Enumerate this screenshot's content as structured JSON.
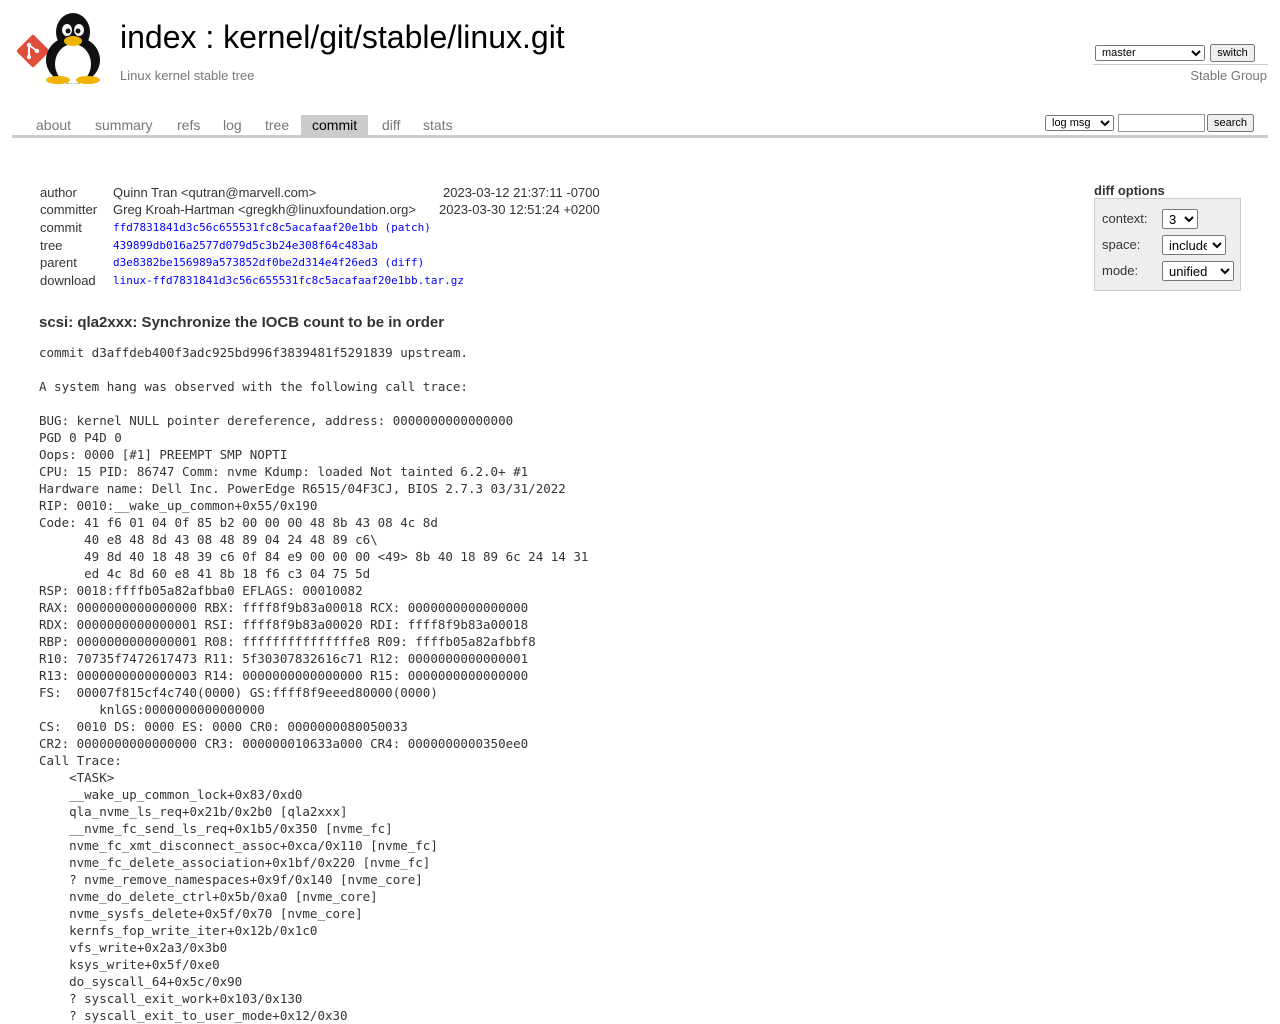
{
  "header": {
    "title_index": "index",
    "title_sep": " : ",
    "title_repo": "kernel/git/stable/linux.git",
    "description": "Linux kernel stable tree",
    "owner": "Stable Group",
    "branch_selected": "master",
    "switch_label": "switch"
  },
  "tabs": [
    {
      "label": "about"
    },
    {
      "label": "summary"
    },
    {
      "label": "refs"
    },
    {
      "label": "log"
    },
    {
      "label": "tree"
    },
    {
      "label": "commit"
    },
    {
      "label": "diff"
    },
    {
      "label": "stats"
    }
  ],
  "active_tab": "commit",
  "search": {
    "mode_selected": "log msg",
    "query": "",
    "button_label": "search"
  },
  "diff_options": {
    "title": "diff options",
    "context_label": "context:",
    "context_value": "3",
    "space_label": "space:",
    "space_value": "include",
    "mode_label": "mode:",
    "mode_value": "unified"
  },
  "commit_info": {
    "author_label": "author",
    "author": "Quinn Tran <qutran@marvell.com>",
    "author_date": "2023-03-12 21:37:11 -0700",
    "committer_label": "committer",
    "committer": "Greg Kroah-Hartman <gregkh@linuxfoundation.org>",
    "committer_date": "2023-03-30 12:51:24 +0200",
    "commit_label": "commit",
    "commit": "ffd7831841d3c56c655531fc8c5acafaaf20e1bb",
    "commit_extra": "(patch)",
    "tree_label": "tree",
    "tree": "439899db016a2577d079d5c3b24e308f64c483ab",
    "parent_label": "parent",
    "parent": "d3e8382be156989a573852df0be2d314e4f26ed3",
    "parent_extra": "(diff)",
    "download_label": "download",
    "download": "linux-ffd7831841d3c56c655531fc8c5acafaaf20e1bb.tar.gz"
  },
  "commit_subject": "scsi: qla2xxx: Synchronize the IOCB count to be in order",
  "commit_message": "commit d3affdeb400f3adc925bd996f3839481f5291839 upstream.\n\nA system hang was observed with the following call trace:\n\nBUG: kernel NULL pointer dereference, address: 0000000000000000\nPGD 0 P4D 0\nOops: 0000 [#1] PREEMPT SMP NOPTI\nCPU: 15 PID: 86747 Comm: nvme Kdump: loaded Not tainted 6.2.0+ #1\nHardware name: Dell Inc. PowerEdge R6515/04F3CJ, BIOS 2.7.3 03/31/2022\nRIP: 0010:__wake_up_common+0x55/0x190\nCode: 41 f6 01 04 0f 85 b2 00 00 00 48 8b 43 08 4c 8d\n      40 e8 48 8d 43 08 48 89 04 24 48 89 c6\\\n      49 8d 40 18 48 39 c6 0f 84 e9 00 00 00 <49> 8b 40 18 89 6c 24 14 31\n      ed 4c 8d 60 e8 41 8b 18 f6 c3 04 75 5d\nRSP: 0018:ffffb05a82afbba0 EFLAGS: 00010082\nRAX: 0000000000000000 RBX: ffff8f9b83a00018 RCX: 0000000000000000\nRDX: 0000000000000001 RSI: ffff8f9b83a00020 RDI: ffff8f9b83a00018\nRBP: 0000000000000001 R08: fffffffffffffffe8 R09: ffffb05a82afbbf8\nR10: 70735f7472617473 R11: 5f30307832616c71 R12: 0000000000000001\nR13: 0000000000000003 R14: 0000000000000000 R15: 0000000000000000\nFS:  00007f815cf4c740(0000) GS:ffff8f9eeed80000(0000)\n        knlGS:0000000000000000\nCS:  0010 DS: 0000 ES: 0000 CR0: 0000000080050033\nCR2: 0000000000000000 CR3: 000000010633a000 CR4: 0000000000350ee0\nCall Trace:\n    <TASK>\n    __wake_up_common_lock+0x83/0xd0\n    qla_nvme_ls_req+0x21b/0x2b0 [qla2xxx]\n    __nvme_fc_send_ls_req+0x1b5/0x350 [nvme_fc]\n    nvme_fc_xmt_disconnect_assoc+0xca/0x110 [nvme_fc]\n    nvme_fc_delete_association+0x1bf/0x220 [nvme_fc]\n    ? nvme_remove_namespaces+0x9f/0x140 [nvme_core]\n    nvme_do_delete_ctrl+0x5b/0xa0 [nvme_core]\n    nvme_sysfs_delete+0x5f/0x70 [nvme_core]\n    kernfs_fop_write_iter+0x12b/0x1c0\n    vfs_write+0x2a3/0x3b0\n    ksys_write+0x5f/0xe0\n    do_syscall_64+0x5c/0x90\n    ? syscall_exit_work+0x103/0x130\n    ? syscall_exit_to_user_mode+0x12/0x30"
}
